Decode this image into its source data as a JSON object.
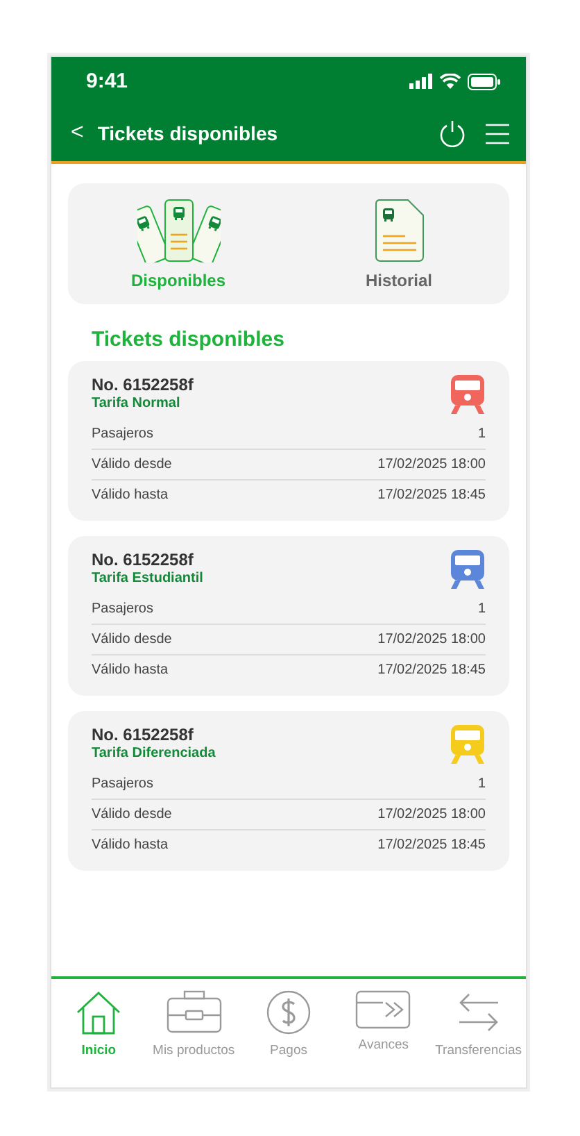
{
  "status_bar": {
    "time": "9:41"
  },
  "header": {
    "back": "<",
    "title": "Tickets disponibles"
  },
  "tabs": [
    {
      "label": "Disponibles",
      "selected": true,
      "kind": "stack"
    },
    {
      "label": "Historial",
      "selected": false,
      "kind": "doc"
    }
  ],
  "section_title": "Tickets disponibles",
  "tickets": [
    {
      "number": "No. 6152258f",
      "fare": "Tarifa Normal",
      "color": "#f0665c",
      "rows": [
        {
          "label": "Pasajeros",
          "value": "1"
        },
        {
          "label": "Válido desde",
          "value": "17/02/2025 18:00"
        },
        {
          "label": "Válido hasta",
          "value": "17/02/2025 18:45"
        }
      ]
    },
    {
      "number": "No. 6152258f",
      "fare": "Tarifa Estudiantil",
      "color": "#5b86d9",
      "rows": [
        {
          "label": "Pasajeros",
          "value": "1"
        },
        {
          "label": "Válido desde",
          "value": "17/02/2025 18:00"
        },
        {
          "label": "Válido hasta",
          "value": "17/02/2025 18:45"
        }
      ]
    },
    {
      "number": "No. 6152258f",
      "fare": "Tarifa Diferenciada",
      "color": "#f5cc1b",
      "rows": [
        {
          "label": "Pasajeros",
          "value": "1"
        },
        {
          "label": "Válido desde",
          "value": "17/02/2025 18:00"
        },
        {
          "label": "Válido hasta",
          "value": "17/02/2025 18:45"
        }
      ]
    }
  ],
  "nav": [
    {
      "label": "Inicio",
      "selected": true,
      "kind": "home"
    },
    {
      "label": "Mis productos",
      "selected": false,
      "kind": "briefcase"
    },
    {
      "label": "Pagos",
      "selected": false,
      "kind": "dollar"
    },
    {
      "label": "Avances",
      "selected": false,
      "kind": "card"
    },
    {
      "label": "Transferencias",
      "selected": false,
      "kind": "transfer"
    }
  ]
}
